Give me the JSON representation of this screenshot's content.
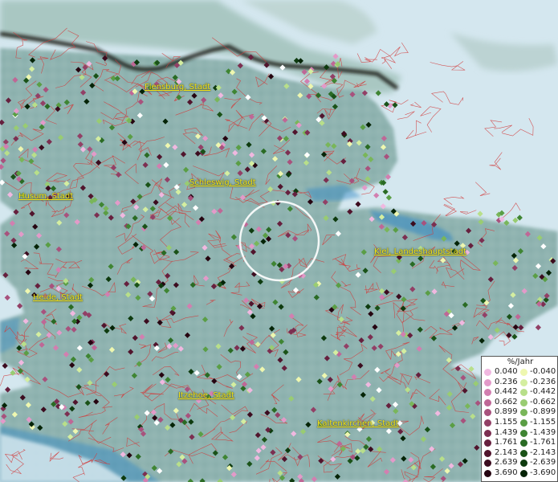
{
  "cities": [
    {
      "label": "Flensburg, Stadt"
    },
    {
      "label": "Schleswig, Stadt"
    },
    {
      "label": "Husum, Stadt"
    },
    {
      "label": "Kiel, Landeshauptstadt"
    },
    {
      "label": "Heide, Stadt"
    },
    {
      "label": "Itzehoe, Stadt"
    },
    {
      "label": "Kaltenkirchen, Stadt"
    }
  ],
  "legend": {
    "title": "%/Jahr",
    "positive": [
      {
        "value": "0.040",
        "color": "#f0b8e0"
      },
      {
        "value": "0.236",
        "color": "#e39ac9"
      },
      {
        "value": "0.442",
        "color": "#d27fb0"
      },
      {
        "value": "0.662",
        "color": "#bf6796"
      },
      {
        "value": "0.899",
        "color": "#a8527d"
      },
      {
        "value": "1.155",
        "color": "#924066"
      },
      {
        "value": "1.439",
        "color": "#7c2f51"
      },
      {
        "value": "1.761",
        "color": "#66203e"
      },
      {
        "value": "2.143",
        "color": "#51152d"
      },
      {
        "value": "2.639",
        "color": "#3c0c1f"
      },
      {
        "value": "3.690",
        "color": "#260511"
      }
    ],
    "negative": [
      {
        "value": "-0.040",
        "color": "#eef7b0"
      },
      {
        "value": "-0.236",
        "color": "#d4eea0"
      },
      {
        "value": "-0.442",
        "color": "#b8df8a"
      },
      {
        "value": "-0.662",
        "color": "#99cc72"
      },
      {
        "value": "-0.899",
        "color": "#79b65a"
      },
      {
        "value": "-1.155",
        "color": "#5a9e45"
      },
      {
        "value": "-1.439",
        "color": "#3f8533"
      },
      {
        "value": "-1.761",
        "color": "#2a6b24"
      },
      {
        "value": "-2.143",
        "color": "#1a5218"
      },
      {
        "value": "-2.639",
        "color": "#0e3b0f"
      },
      {
        "value": "-3.690",
        "color": "#052407"
      }
    ]
  },
  "colors": {
    "sea": "#d4e7ef",
    "land": "#8fb3b0",
    "border": "#d23a3a",
    "national_border": "#1e1a18",
    "highlight_circle": "#ffffff",
    "label": "#f2e21a"
  }
}
